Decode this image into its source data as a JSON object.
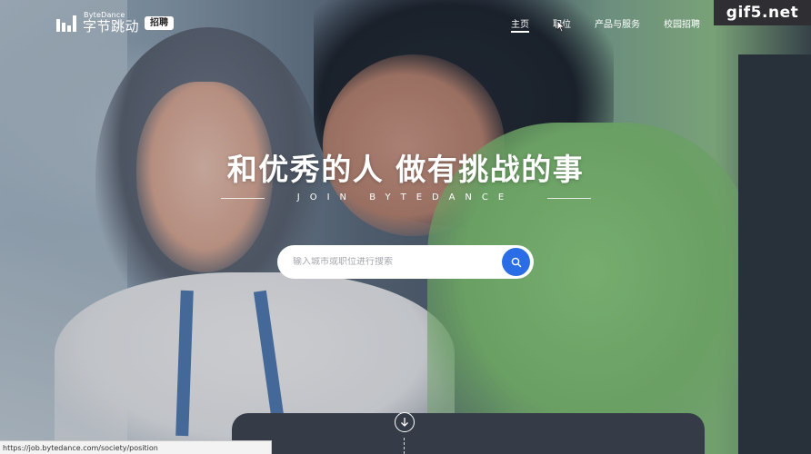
{
  "brand": {
    "name_en": "ByteDance",
    "name_cn": "字节跳动",
    "badge": "招聘"
  },
  "nav": {
    "items": [
      {
        "label": "主页",
        "active": true
      },
      {
        "label": "职位",
        "active": false
      },
      {
        "label": "产品与服务",
        "active": false
      },
      {
        "label": "校园招聘",
        "active": false
      }
    ]
  },
  "watermark": "gif5.net",
  "hero": {
    "title": "和优秀的人 做有挑战的事",
    "subtitle": "JOIN BYTEDANCE"
  },
  "search": {
    "placeholder": "输入城市或职位进行搜索",
    "value": "",
    "button_color": "#2b6de6"
  },
  "status_bar": {
    "url": "https://job.bytedance.com/society/position"
  },
  "icons": {
    "logo": "bytedance-bars-logo",
    "search": "search-icon",
    "scroll": "arrow-down-circle-icon",
    "cursor": "mouse-pointer-icon"
  }
}
